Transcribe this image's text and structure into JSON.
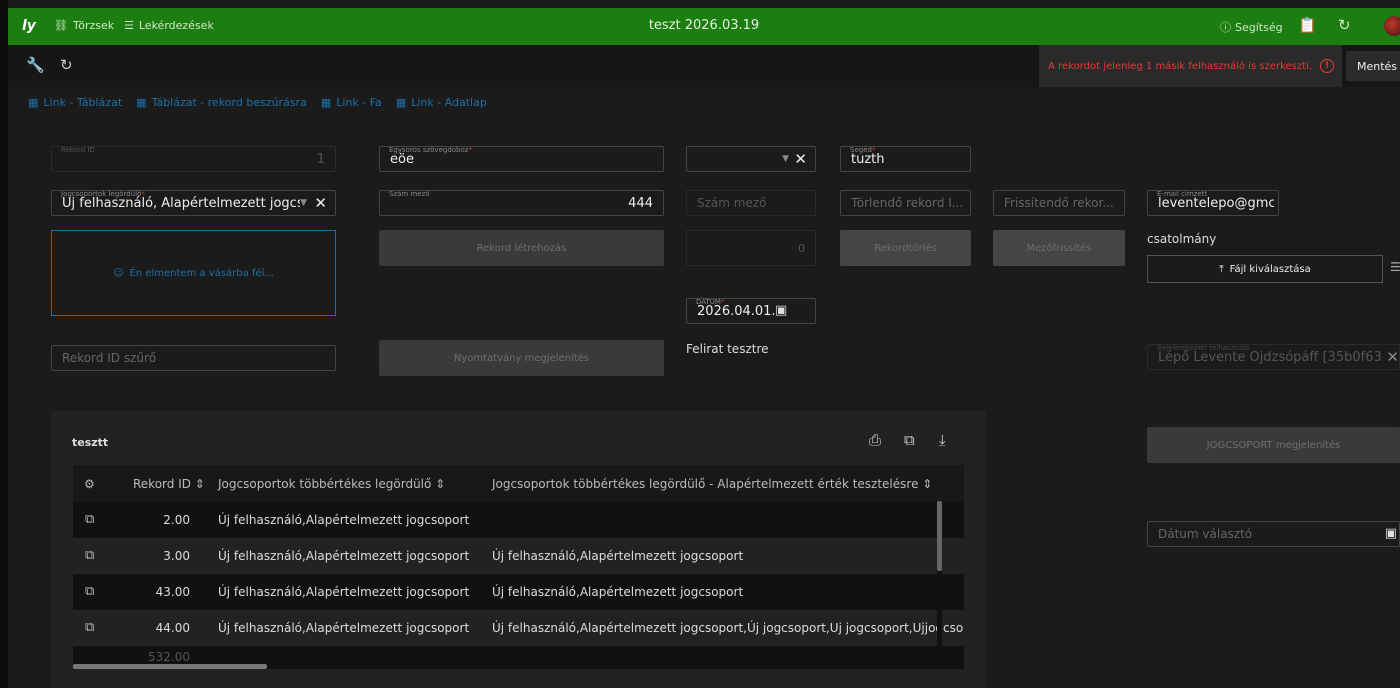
{
  "topbar": {
    "logo": "ly",
    "nav": [
      {
        "label": "Törzsek",
        "icon": "network-icon"
      },
      {
        "label": "Lekérdezések",
        "icon": "document-list-icon"
      }
    ],
    "title": "teszt 2026.03.19",
    "help_label": "Segítség"
  },
  "toolbar": {
    "warning_text": "A rekordot jelenleg 1 másik felhasználó is szerkeszti.",
    "save_label": "Mentés"
  },
  "links": [
    {
      "label": "Link - Táblázat"
    },
    {
      "label": "Táblázat - rekord beszúrásra"
    },
    {
      "label": "Link - Fa"
    },
    {
      "label": "Link - Adatlap"
    }
  ],
  "form": {
    "rekord_id": {
      "label": "Rekord ID",
      "value": "1"
    },
    "egysoros": {
      "label": "Egysoros szövegdoboz",
      "value": "eöe"
    },
    "seged": {
      "label": "Segéd",
      "value": "tuzth"
    },
    "jogcsoportok": {
      "label": "Jogcsoportok legördülő",
      "value": "Új felhasználó, Alapértelmezett jogcs..."
    },
    "szam_mezo": {
      "label": "Szám mező",
      "value": "444"
    },
    "szam_mezo_2": {
      "placeholder": "Szám mező"
    },
    "torlendo": {
      "placeholder": "Törlendő rekord I..."
    },
    "frissitendo": {
      "placeholder": "Frissítendő rekor..."
    },
    "email": {
      "label": "E-mail címzett",
      "value": "leventelepo@gmc"
    },
    "drop_zone_text": "Én elmentem a vásárba fél...",
    "rekord_letrehozas": "Rekord létrehozás",
    "number_zero": "0",
    "rekordtorles": "Rekordtörlés",
    "mezofrissites": "Mezőfrissítés",
    "csatolmany": "csatolmány",
    "fajl_kivalasztasa": "Fájl kiválasztása",
    "datum": {
      "label": "DÁTUM",
      "value": "2026.04.01."
    },
    "rekord_id_szuro": "Rekord ID szűrő",
    "nyomtatvany": "Nyomtatvány megjelenítés",
    "felirat": "Felirat tesztre",
    "bejelentkezett": {
      "label": "Bejelentkezett felhasználó",
      "value": "Lépő Levente Ojdzsópáff [35b0f63..."
    },
    "jogcsoport_btn": "JOGCSOPORT megjelenítés",
    "datum_valaszto": "Dátum választó"
  },
  "table": {
    "title": "tesztt",
    "columns": [
      "Rekord ID",
      "Jogcsoportok többértékes legördülő",
      "Jogcsoportok többértékes legördülő - Alapértelmezett érték tesztelésre"
    ],
    "rows": [
      {
        "id": "2.00",
        "c1": "Új felhasználó,Alapértelmezett jogcsoport",
        "c2": ""
      },
      {
        "id": "3.00",
        "c1": "Új felhasználó,Alapértelmezett jogcsoport",
        "c2": "Új felhasználó,Alapértelmezett jogcsoport"
      },
      {
        "id": "43.00",
        "c1": "Új felhasználó,Alapértelmezett jogcsoport",
        "c2": "Új felhasználó,Alapértelmezett jogcsoport"
      },
      {
        "id": "44.00",
        "c1": "Új felhasználó,Alapértelmezett jogcsoport",
        "c2": "Új felhasználó,Alapértelmezett jogcsoport,Új jogcsoport,Uj jogcsoport,Ujjogcsop"
      },
      {
        "id": "532.00",
        "c1": "",
        "c2": ""
      }
    ]
  },
  "colors": {
    "green": "#1c7d10",
    "link_blue": "#1e6fa8",
    "warning_red": "#e53935"
  }
}
